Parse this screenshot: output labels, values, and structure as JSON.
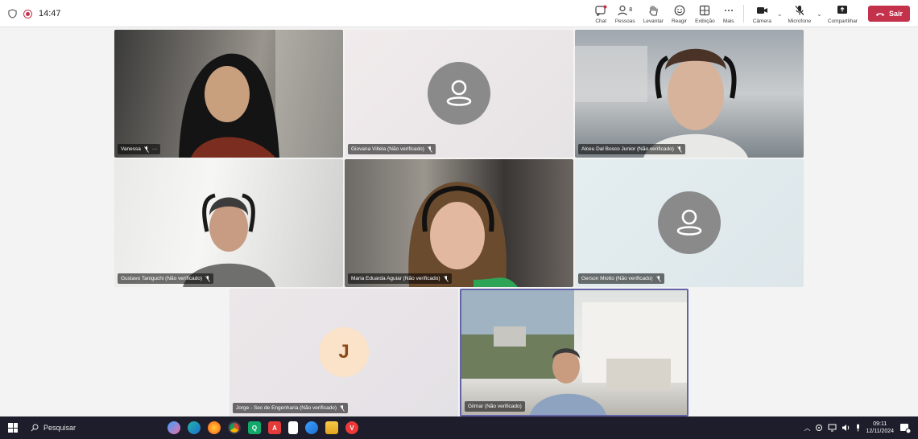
{
  "topbar": {
    "time": "14:47",
    "controls": [
      {
        "key": "chat",
        "label": "Chat"
      },
      {
        "key": "people",
        "label": "Pessoas",
        "count": "8"
      },
      {
        "key": "raise",
        "label": "Levantar"
      },
      {
        "key": "react",
        "label": "Reagir"
      },
      {
        "key": "view",
        "label": "Exibição"
      },
      {
        "key": "more",
        "label": "Mais"
      }
    ],
    "camera_label": "Câmera",
    "mic_label": "Microfone",
    "share_label": "Compartilhar",
    "leave_label": "Sair"
  },
  "participants": [
    {
      "name": "Vanessa",
      "type": "video",
      "extra": "···"
    },
    {
      "name": "Giovana Villela (Não verificado)",
      "type": "avatar"
    },
    {
      "name": "Alceu Dal Bosco Junior (Não verificado)",
      "type": "video"
    },
    {
      "name": "Gustavo Taniguchi (Não verificado)",
      "type": "video"
    },
    {
      "name": "Maria Eduarda Aguiar (Não verificado)",
      "type": "video"
    },
    {
      "name": "Gerson Miotto (Não verificado)",
      "type": "avatar"
    },
    {
      "name": "Jorge - Sec de Engenharia (Não verificado)",
      "type": "initial",
      "initial": "J"
    },
    {
      "name": "Gilmar (Não verificado)",
      "type": "video",
      "active": true
    }
  ],
  "taskbar": {
    "search_label": "Pesquisar",
    "clock_time": "09:11",
    "clock_date": "12/11/2024",
    "notif_count": "3"
  },
  "colors": {
    "leave": "#c4314b",
    "active_border": "#6264a7",
    "taskbar": "#1e1d2b"
  }
}
